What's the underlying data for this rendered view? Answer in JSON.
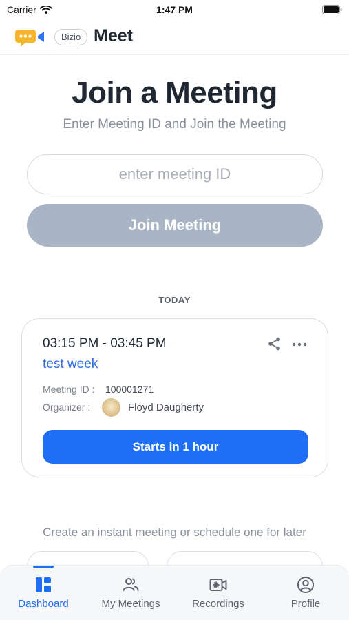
{
  "status_bar": {
    "carrier": "Carrier",
    "time": "1:47 PM"
  },
  "header": {
    "brand_pill": "Bizio",
    "title": "Meet"
  },
  "join": {
    "title": "Join a Meeting",
    "subtitle": "Enter Meeting ID and Join the Meeting",
    "input_placeholder": "enter meeting ID",
    "input_value": "",
    "button_label": "Join Meeting"
  },
  "today_section": {
    "label": "TODAY"
  },
  "meeting": {
    "time_range": "03:15 PM - 03:45 PM",
    "name": "test week",
    "id_label": "Meeting ID :",
    "id_value": "100001271",
    "organizer_label": "Organizer :",
    "organizer_name": "Floyd Daugherty",
    "status_button": "Starts in 1 hour"
  },
  "instant": {
    "text": "Create an instant meeting or schedule one for later"
  },
  "tabs": [
    {
      "label": "Dashboard",
      "icon": "dashboard-icon",
      "active": true
    },
    {
      "label": "My Meetings",
      "icon": "people-icon",
      "active": false
    },
    {
      "label": "Recordings",
      "icon": "video-recording-icon",
      "active": false
    },
    {
      "label": "Profile",
      "icon": "profile-icon",
      "active": false
    }
  ],
  "colors": {
    "accent": "#1f6ef5",
    "link": "#2f6fe0",
    "disabled_button": "#a9b5c4",
    "logo_yellow": "#f5b52e",
    "logo_blue": "#2d73f0"
  }
}
